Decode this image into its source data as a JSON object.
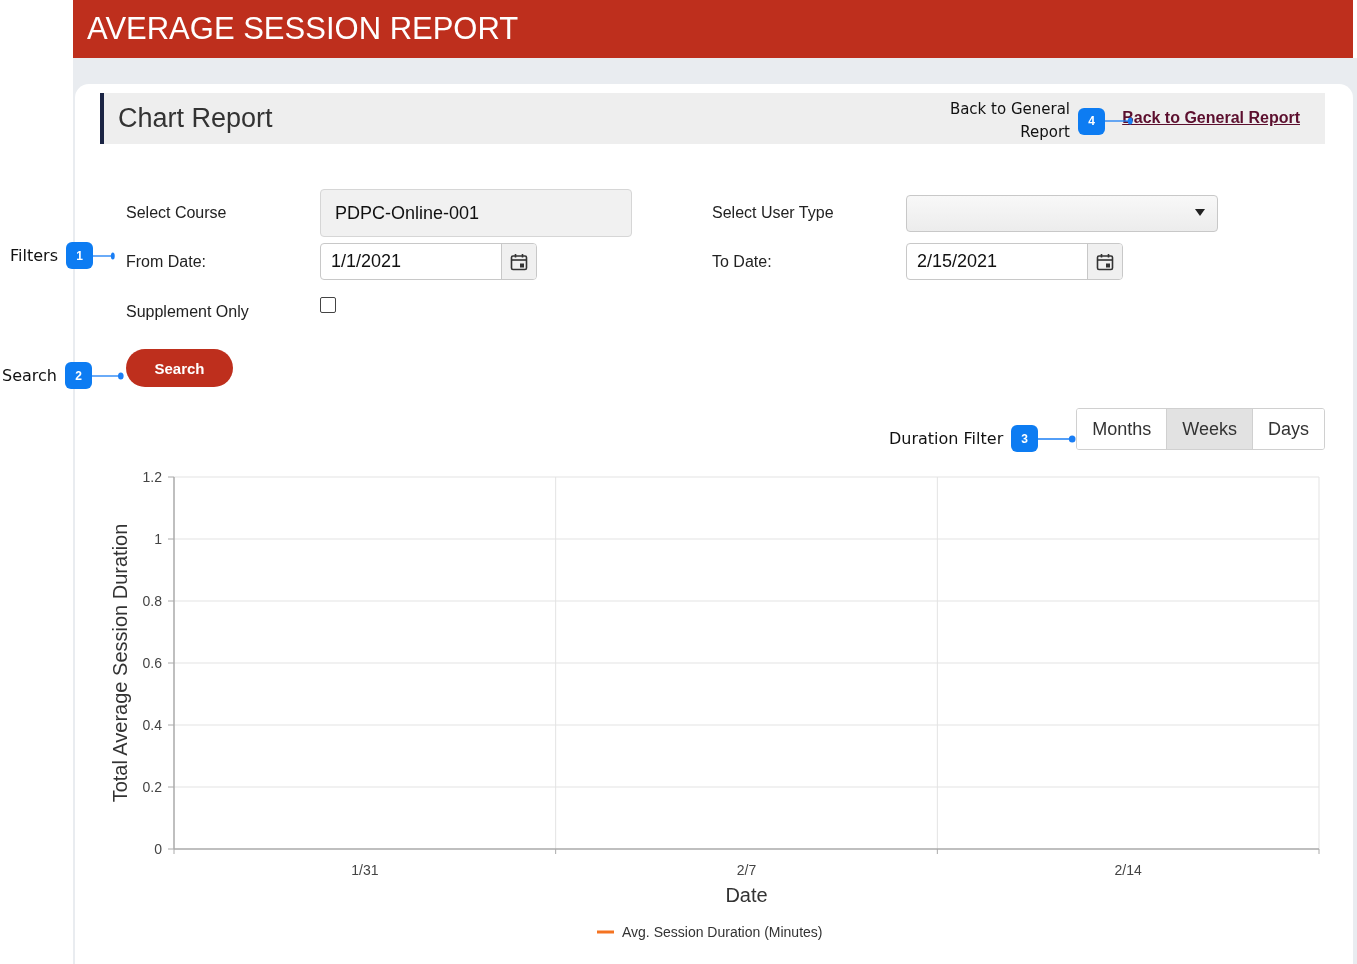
{
  "header": {
    "title": "AVERAGE SESSION REPORT"
  },
  "panel": {
    "title": "Chart Report",
    "link": "Back to General Report"
  },
  "filters": [
    {
      "kind": "combo",
      "label": "Select Course",
      "value": "PDPC-Online-001"
    },
    {
      "kind": "dropdown",
      "label": "Select User Type"
    },
    {
      "kind": "date",
      "label": "From Date:",
      "value": "1/1/2021"
    },
    {
      "kind": "date",
      "label": "To Date:",
      "value": "2/15/2021"
    },
    {
      "kind": "checkbox",
      "label": "Supplement Only",
      "checked": false
    }
  ],
  "search_button": "Search",
  "duration_filter": [
    {
      "label": "Months",
      "selected": false
    },
    {
      "label": "Weeks",
      "selected": true
    },
    {
      "label": "Days",
      "selected": false
    }
  ],
  "chart": {
    "chart_data": {
      "type": "line",
      "xlabel": "Date",
      "ylabel": "Total Average Session Duration",
      "categories": [
        "1/31",
        "2/7",
        "2/14"
      ],
      "series": [
        {
          "name": "Avg. Session Duration (Minutes)",
          "color": "#f47321",
          "values": [
            null,
            null,
            null
          ]
        }
      ],
      "grid": true,
      "ylim": [
        0,
        1.2
      ],
      "yticks": [
        0,
        0.2,
        0.4,
        0.6,
        0.8,
        1,
        1.2
      ]
    }
  },
  "callouts": [
    {
      "number": "1",
      "label": "Filters"
    },
    {
      "number": "2",
      "label": "Search"
    },
    {
      "number": "3",
      "label": "Duration Filter"
    },
    {
      "number": "4",
      "label": "Back to General Report"
    }
  ]
}
